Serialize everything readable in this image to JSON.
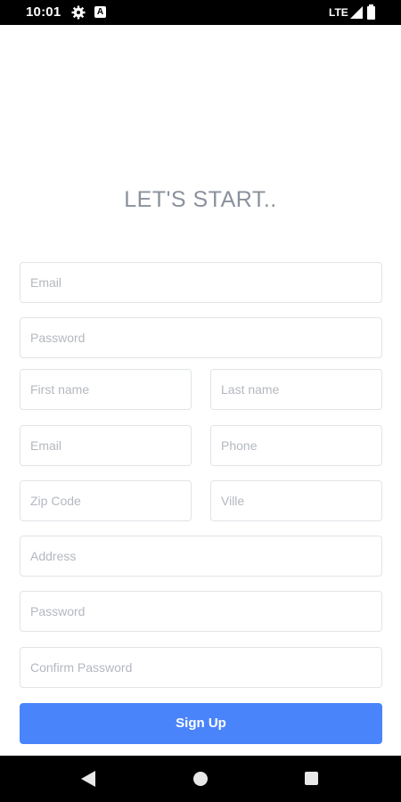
{
  "status_bar": {
    "time": "10:01",
    "network": "LTE",
    "icons": [
      "settings-gear-icon",
      "a-notification-icon",
      "signal-icon",
      "battery-icon"
    ]
  },
  "form": {
    "title": "LET'S START..",
    "fields": {
      "email_1": {
        "placeholder": "Email",
        "value": ""
      },
      "password_1": {
        "placeholder": "Password",
        "value": ""
      },
      "first_name": {
        "placeholder": "First name",
        "value": ""
      },
      "last_name": {
        "placeholder": "Last name",
        "value": ""
      },
      "email_2": {
        "placeholder": "Email",
        "value": ""
      },
      "phone": {
        "placeholder": "Phone",
        "value": ""
      },
      "zip_code": {
        "placeholder": "Zip Code",
        "value": ""
      },
      "ville": {
        "placeholder": "Ville",
        "value": ""
      },
      "address": {
        "placeholder": "Address",
        "value": ""
      },
      "password_2": {
        "placeholder": "Password",
        "value": ""
      },
      "confirm_password": {
        "placeholder": "Confirm Password",
        "value": ""
      }
    },
    "submit_label": "Sign Up"
  },
  "nav_bar": {
    "icons": [
      "back-icon",
      "home-icon",
      "recent-apps-icon"
    ]
  },
  "colors": {
    "primary_button": "#4a84fb",
    "title_text": "#8a919c",
    "field_border": "#e1e4e8",
    "placeholder": "#b3b8bf"
  }
}
